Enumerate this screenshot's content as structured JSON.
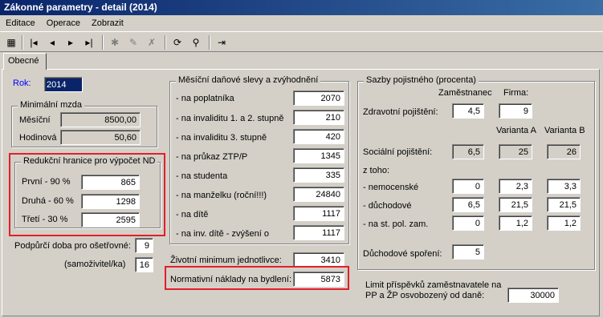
{
  "window": {
    "title": "Zákonné parametry - detail (2014)"
  },
  "menu": {
    "editace": "Editace",
    "operace": "Operace",
    "zobrazit": "Zobrazit"
  },
  "tab": {
    "label": "Obecné"
  },
  "rok": {
    "label": "Rok:",
    "value": "2014"
  },
  "min_mzda": {
    "title": "Minimální mzda",
    "mesicni_label": "Měsíční",
    "mesicni": "8500,00",
    "hodinova_label": "Hodinová",
    "hodinova": "50,60"
  },
  "redukcni": {
    "title": "Redukční hranice pro výpočet ND",
    "rows": [
      {
        "label": "První - 90 %",
        "value": "865"
      },
      {
        "label": "Druhá - 60 %",
        "value": "1298"
      },
      {
        "label": "Třetí - 30 %",
        "value": "2595"
      }
    ]
  },
  "podpurci": {
    "label": "Podpůrčí doba pro ošetřovné:",
    "value": "9",
    "label2": "(samoživitel/ka)",
    "value2": "16"
  },
  "slevy": {
    "title": "Měsíční daňové slevy a zvýhodnění",
    "rows": [
      {
        "label": "- na poplatníka",
        "value": "2070"
      },
      {
        "label": "- na invaliditu 1. a 2. stupně",
        "value": "210"
      },
      {
        "label": "- na invaliditu 3. stupně",
        "value": "420"
      },
      {
        "label": "- na průkaz ZTP/P",
        "value": "1345"
      },
      {
        "label": "- na studenta",
        "value": "335"
      },
      {
        "label": "- na manželku (roční!!!)",
        "value": "24840"
      },
      {
        "label": "- na dítě",
        "value": "1117"
      },
      {
        "label": "- na inv. dítě - zvýšení o",
        "value": "1117"
      }
    ]
  },
  "zivotni_minimum": {
    "label": "Životní minimum jednotlivce:",
    "value": "3410"
  },
  "normativni": {
    "label": "Normativní náklady na bydlení:",
    "value": "5873"
  },
  "sazby": {
    "title": "Sazby pojistného (procenta)",
    "zamestnanec": "Zaměstnanec",
    "firma": "Firma:",
    "varianta_a": "Varianta A",
    "varianta_b": "Varianta B",
    "zdravotni": {
      "label": "Zdravotní pojištění:",
      "zam": "4,5",
      "firma": "9"
    },
    "socialni": {
      "label": "Sociální pojištění:",
      "zam": "6,5",
      "a": "25",
      "b": "26"
    },
    "ztoho": "z toho:",
    "nemocenske": {
      "label": "- nemocenské",
      "zam": "0",
      "a": "2,3",
      "b": "3,3"
    },
    "duchodove": {
      "label": "- důchodové",
      "zam": "6,5",
      "a": "21,5",
      "b": "21,5"
    },
    "st_pol": {
      "label": "- na st. pol. zam.",
      "zam": "0",
      "a": "1,2",
      "b": "1,2"
    },
    "duchodove_sporeni": {
      "label": "Důchodové spoření:",
      "value": "5"
    }
  },
  "limit": {
    "line1": "Limit příspěvků zaměstnavatele na",
    "line2": "PP a ŽP osvobozený od daně:",
    "value": "30000"
  },
  "accent": {
    "title_start": "#0a246a",
    "title_end": "#3a6ea5",
    "highlight": "#e0202a"
  }
}
